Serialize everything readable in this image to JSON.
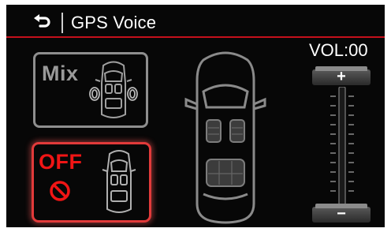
{
  "header": {
    "back_icon": "back-arrow-icon",
    "title": "GPS Voice"
  },
  "modes": [
    {
      "label": "Mix",
      "icon": "car-speakers-icon",
      "selected": false
    },
    {
      "label": "OFF",
      "icon": "no-sign-icon",
      "selected": true
    }
  ],
  "volume": {
    "label": "VOL:00",
    "value": 0,
    "increase_label": "+",
    "decrease_label": "−"
  },
  "colors": {
    "background": "#070707",
    "accent_red": "#c5101c",
    "selected_border": "#e23a3a",
    "off_text": "#f01515",
    "inactive_gray": "#8e8e8e"
  }
}
